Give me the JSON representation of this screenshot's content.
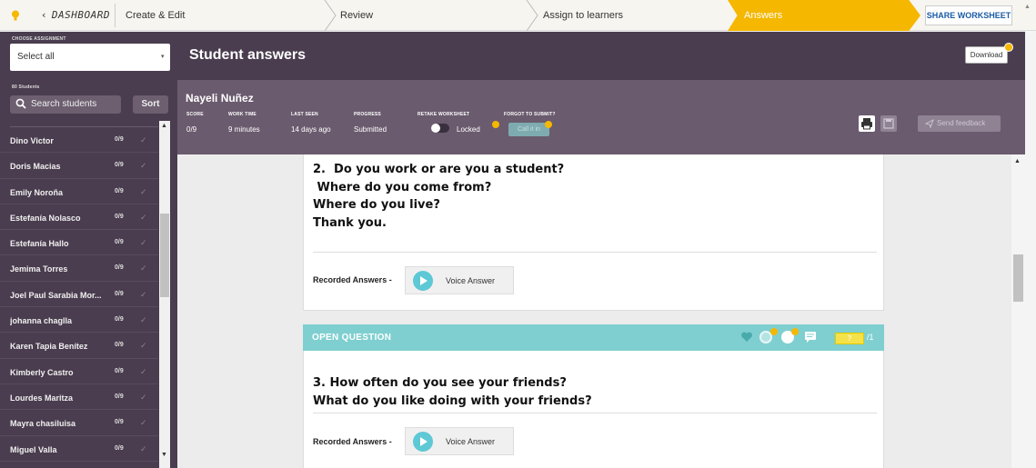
{
  "nav": {
    "back_label": "DASHBOARD",
    "steps": [
      "Create & Edit",
      "Review",
      "Assign to learners"
    ],
    "active_step": "Answers",
    "share_label": "SHARE WORKSHEET",
    "accent_color": "#f5b700"
  },
  "sidebar": {
    "assignment_label": "CHOOSE ASSIGNMENT",
    "assignment_value": "Select all",
    "students_count_label": "80 Students",
    "search_placeholder": "Search students",
    "sort_label": "Sort",
    "students": [
      {
        "name": "Dino Victor",
        "score": "0/9"
      },
      {
        "name": "Doris Macias",
        "score": "0/9"
      },
      {
        "name": "Emily Noroña",
        "score": "0/9"
      },
      {
        "name": "Estefanía Nolasco",
        "score": "0/9"
      },
      {
        "name": "Estefanía Hallo",
        "score": "0/9"
      },
      {
        "name": "Jemima Torres",
        "score": "0/9"
      },
      {
        "name": "Joel Paul Sarabia Mor...",
        "score": "0/9"
      },
      {
        "name": "johanna chaglla",
        "score": "0/9"
      },
      {
        "name": "Karen Tapia Benítez",
        "score": "0/9"
      },
      {
        "name": "Kimberly Castro",
        "score": "0/9"
      },
      {
        "name": "Lourdes Maritza",
        "score": "0/9"
      },
      {
        "name": "Mayra chasiluisa",
        "score": "0/9"
      },
      {
        "name": "Miguel Valla",
        "score": "0/9"
      }
    ]
  },
  "header": {
    "title": "Student answers",
    "download_label": "Download"
  },
  "student": {
    "name": "Nayeli Nuñez",
    "score_label": "SCORE",
    "score": "0/9",
    "worktime_label": "WORK TIME",
    "worktime": "9 minutes",
    "lastseen_label": "LAST SEEN",
    "lastseen": "14 days ago",
    "progress_label": "PROGRESS",
    "progress": "Submitted",
    "retake_label": "RETAKE WORKSHEET",
    "retake_value": "Locked",
    "forgot_label": "FORGOT TO SUBMIT?",
    "callit_label": "Call it in",
    "feedback_label": "Send feedback"
  },
  "questions": {
    "q2_text": "2.  Do you work or are you a student?\n Where do you come from?\nWhere do you live?\nThank you.",
    "recorded_label": "Recorded Answers -",
    "voice_label": "Voice Answer",
    "open_question_label": "OPEN QUESTION",
    "points_value": "?",
    "points_total": "/1",
    "q3_text": "3. How often do you see your friends?\nWhat do you like doing with your friends?"
  }
}
